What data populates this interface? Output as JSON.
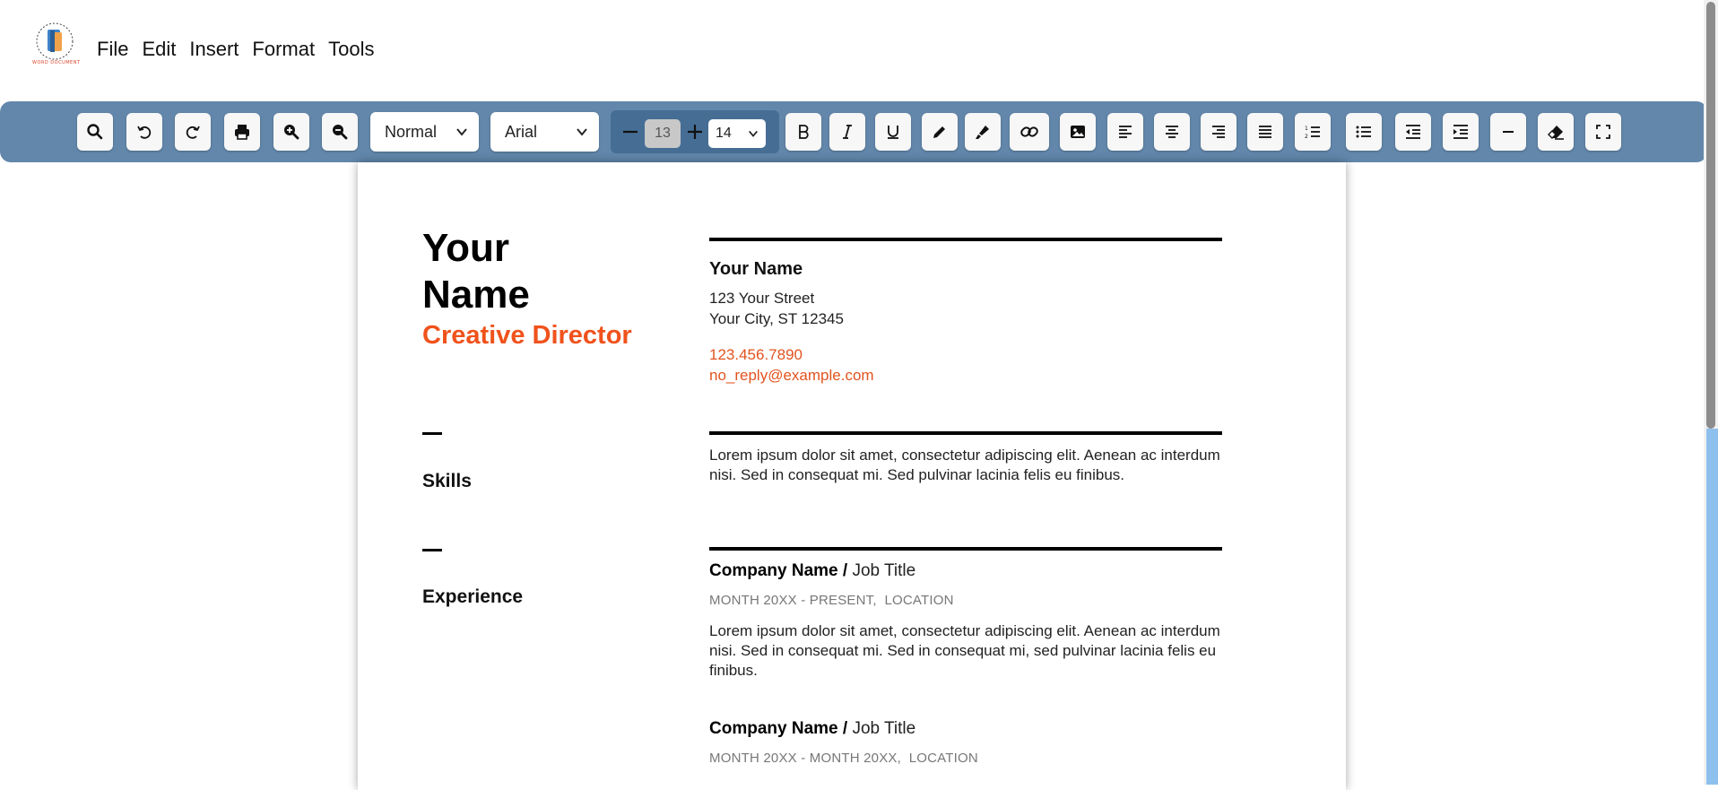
{
  "menu": {
    "items": [
      "File",
      "Edit",
      "Insert",
      "Format",
      "Tools"
    ]
  },
  "toolbar": {
    "paragraph_style": "Normal",
    "font_family": "Arial",
    "font_size_value": "13",
    "font_size_select": "14",
    "buttons": [
      "search-icon",
      "undo-icon",
      "redo-icon",
      "print-icon",
      "zoom-in-icon",
      "zoom-out-icon",
      "bold-icon",
      "italic-icon",
      "underline-icon",
      "pencil-icon",
      "highlighter-icon",
      "link-icon",
      "image-icon",
      "align-left-icon",
      "align-center-icon",
      "align-right-icon",
      "align-justify-icon",
      "numbered-list-icon",
      "bullet-list-icon",
      "outdent-icon",
      "indent-icon",
      "horizontal-rule-icon",
      "eraser-icon",
      "fullscreen-icon"
    ]
  },
  "colors": {
    "toolbar_bg": "#6287ab",
    "accent_orange": "#f0521c",
    "scroll_accent": "#8ec0ee"
  },
  "document": {
    "name_line1": "Your",
    "name_line2": "Name",
    "role": "Creative Director",
    "contact": {
      "name": "Your Name",
      "street": "123 Your Street",
      "city": "Your City, ST 12345",
      "phone": "123.456.7890",
      "email": "no_reply@example.com"
    },
    "skills": {
      "title": "Skills",
      "text": "Lorem ipsum dolor sit amet, consectetur adipiscing elit. Aenean ac interdum nisi. Sed in consequat mi. Sed pulvinar lacinia felis eu finibus."
    },
    "experience": {
      "title": "Experience",
      "jobs": [
        {
          "company": "Company Name",
          "separator": " / ",
          "title": "Job Title",
          "dates": "MONTH 20XX - PRESENT,  LOCATION",
          "description": "Lorem ipsum dolor sit amet, consectetur adipiscing elit. Aenean ac interdum nisi. Sed in consequat mi. Sed in consequat mi, sed pulvinar lacinia felis eu finibus."
        },
        {
          "company": "Company Name",
          "separator": " / ",
          "title": "Job Title",
          "dates": "MONTH 20XX - MONTH 20XX,  LOCATION"
        }
      ]
    }
  }
}
